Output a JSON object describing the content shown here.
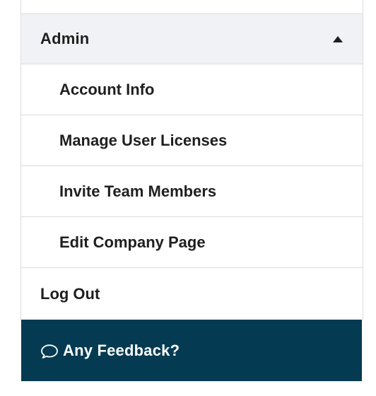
{
  "menu": {
    "admin_section": {
      "title": "Admin",
      "expanded": true,
      "caret_icon": "caret-up-icon",
      "items": [
        {
          "label": "Account Info"
        },
        {
          "label": "Manage User Licenses"
        },
        {
          "label": "Invite Team Members"
        },
        {
          "label": "Edit Company Page"
        }
      ]
    },
    "logout_label": "Log Out"
  },
  "feedback": {
    "icon": "speech-bubble-icon",
    "label": "Any Feedback?",
    "background_color": "#053b52"
  },
  "colors": {
    "section_header_bg": "#f1f2f6",
    "divider": "#dcdcdc",
    "text": "#1f1f1f"
  }
}
